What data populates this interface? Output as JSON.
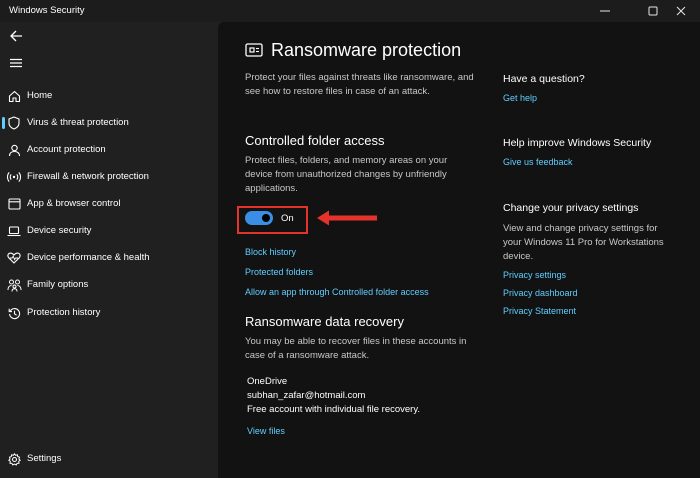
{
  "window": {
    "title": "Windows Security",
    "minimize_glyph": "—",
    "maximize_glyph": "☐",
    "close_glyph": "✕"
  },
  "sidebar": {
    "items": [
      {
        "label": "Home",
        "icon": "home-icon"
      },
      {
        "label": "Virus & threat protection",
        "icon": "shield-icon",
        "active": true
      },
      {
        "label": "Account protection",
        "icon": "person-icon"
      },
      {
        "label": "Firewall & network protection",
        "icon": "wifi-icon"
      },
      {
        "label": "App & browser control",
        "icon": "app-window-icon"
      },
      {
        "label": "Device security",
        "icon": "laptop-icon"
      },
      {
        "label": "Device performance & health",
        "icon": "heart-icon"
      },
      {
        "label": "Family options",
        "icon": "family-icon"
      },
      {
        "label": "Protection history",
        "icon": "history-icon"
      }
    ],
    "settings_label": "Settings"
  },
  "main": {
    "title": "Ransomware protection",
    "intro": "Protect your files against threats like ransomware, and see how to restore files in case of an attack.",
    "cfa": {
      "heading": "Controlled folder access",
      "description": "Protect files, folders, and memory areas on your device from unauthorized changes by unfriendly applications.",
      "toggle_label": "On",
      "links": [
        "Block history",
        "Protected folders",
        "Allow an app through Controlled folder access"
      ]
    },
    "recovery": {
      "heading": "Ransomware data recovery",
      "description": "You may be able to recover files in these accounts in case of a ransomware attack.",
      "provider": "OneDrive",
      "email": "subhan_zafar@hotmail.com",
      "account_type": "Free account with individual file recovery.",
      "view_files": "View files"
    }
  },
  "aside": {
    "question": {
      "heading": "Have a question?",
      "link": "Get help"
    },
    "improve": {
      "heading": "Help improve Windows Security",
      "link": "Give us feedback"
    },
    "privacy": {
      "heading": "Change your privacy settings",
      "description": "View and change privacy settings for your Windows 11 Pro for Workstations device.",
      "links": [
        "Privacy settings",
        "Privacy dashboard",
        "Privacy Statement"
      ]
    }
  },
  "colors": {
    "accent_link": "#60cdff",
    "toggle_on": "#3b8ee6",
    "highlight_red": "#e5322b"
  }
}
